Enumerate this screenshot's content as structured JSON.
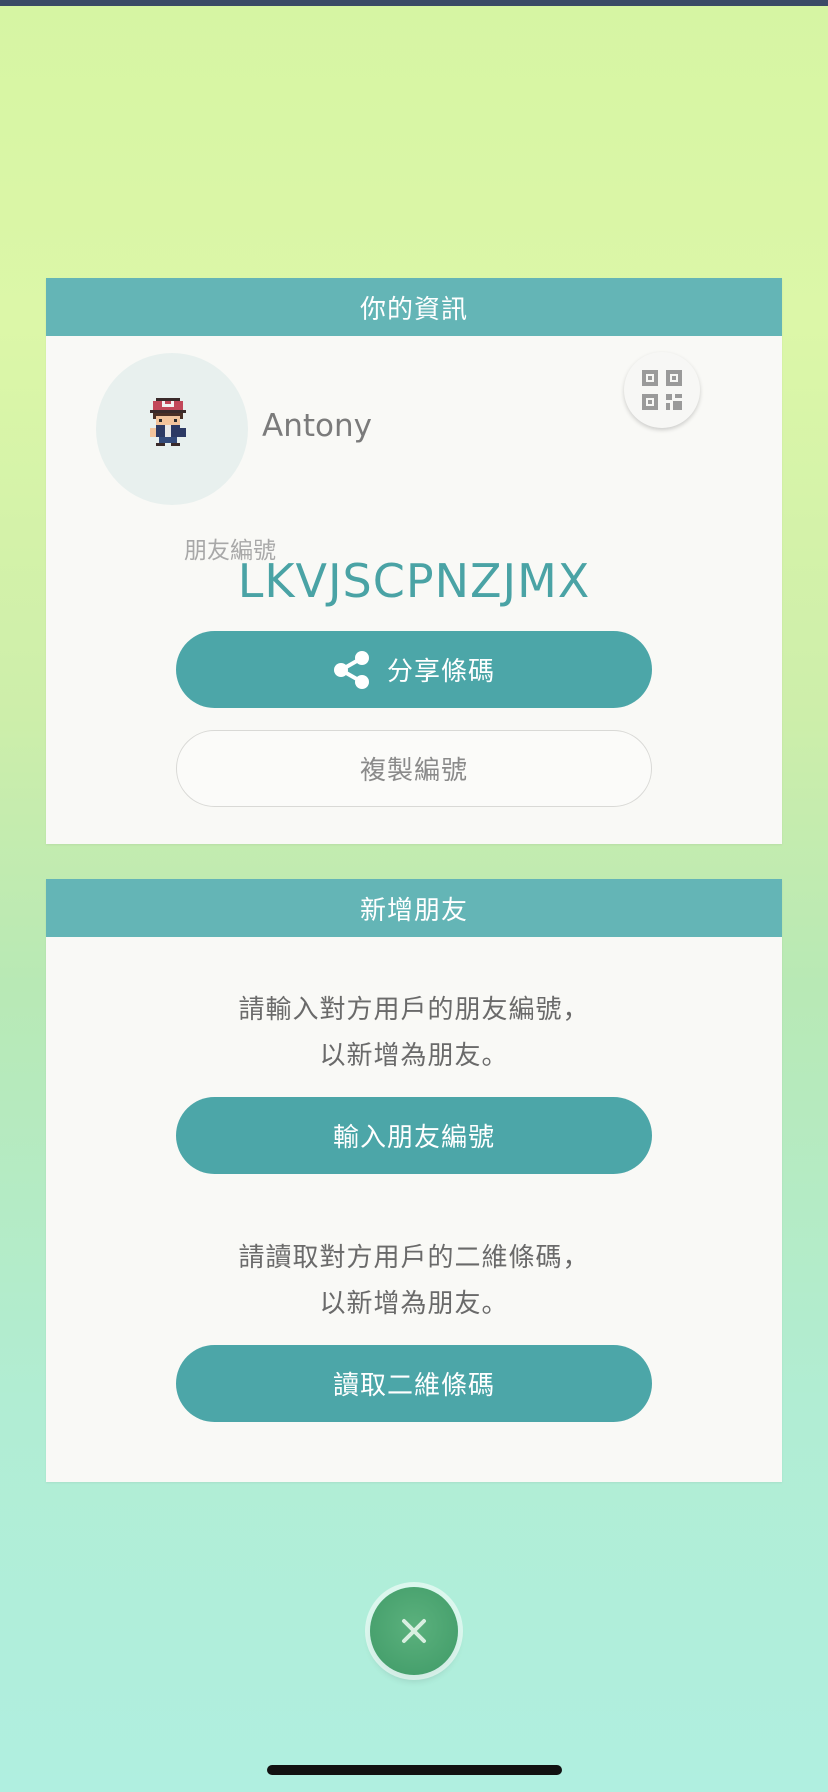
{
  "your_info": {
    "title": "你的資訊",
    "username": "Antony",
    "friend_code_label": "朋友編號",
    "friend_code": "LKVJSCPNZJMX",
    "share_button_label": "分享條碼",
    "copy_button_label": "複製編號",
    "icons": {
      "avatar": "trainer-avatar-icon",
      "qr": "qr-code-icon",
      "share": "share-icon"
    }
  },
  "add_friend": {
    "title": "新增朋友",
    "enter_instruction_line1": "請輸入對方用戶的朋友編號，",
    "enter_instruction_line2": "以新增為朋友。",
    "enter_button_label": "輸入朋友編號",
    "scan_instruction_line1": "請讀取對方用戶的二維條碼，",
    "scan_instruction_line2": "以新增為朋友。",
    "scan_button_label": "讀取二維條碼"
  },
  "close_icon": "close-icon",
  "colors": {
    "header": "#64b5b6",
    "primary_button": "#4ca6a8",
    "friend_code": "#4aa3a5",
    "close_button": "#4aa572"
  }
}
